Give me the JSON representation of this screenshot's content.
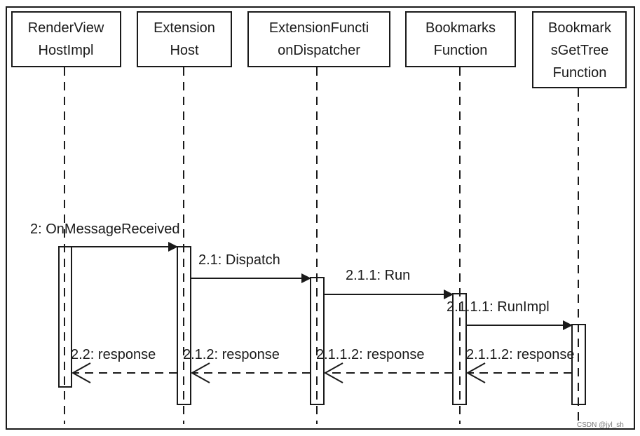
{
  "diagram": {
    "type": "uml-sequence-diagram",
    "colors": {
      "stroke": "#1a1a1a",
      "background": "#ffffff",
      "watermark": "#7a7a7a"
    },
    "lifelines": [
      {
        "id": "rvhi",
        "lines": [
          "RenderView",
          "HostImpl"
        ]
      },
      {
        "id": "eh",
        "lines": [
          "Extension",
          "Host"
        ]
      },
      {
        "id": "efd",
        "lines": [
          "ExtensionFuncti",
          "onDispatcher"
        ]
      },
      {
        "id": "bf",
        "lines": [
          "Bookmarks",
          "Function"
        ]
      },
      {
        "id": "bgtf",
        "lines": [
          "Bookmark",
          "sGetTree",
          "Function"
        ]
      }
    ],
    "messages": [
      {
        "label": "2: OnMessageReceived",
        "from": "rvhi",
        "to": "eh",
        "kind": "sync"
      },
      {
        "label": "2.1: Dispatch",
        "from": "eh",
        "to": "efd",
        "kind": "sync"
      },
      {
        "label": "2.1.1: Run",
        "from": "efd",
        "to": "bf",
        "kind": "sync"
      },
      {
        "label": "2.1.1.1: RunImpl",
        "from": "bf",
        "to": "bgtf",
        "kind": "sync"
      },
      {
        "label": "2.1.1.2: response",
        "from": "bgtf",
        "to": "bf",
        "kind": "return"
      },
      {
        "label": "2.1.1.2: response",
        "from": "bf",
        "to": "efd",
        "kind": "return"
      },
      {
        "label": "2.1.2: response",
        "from": "efd",
        "to": "eh",
        "kind": "return"
      },
      {
        "label": "2.2: response",
        "from": "eh",
        "to": "rvhi",
        "kind": "return"
      }
    ],
    "watermark": "CSDN @jyl_sh"
  }
}
